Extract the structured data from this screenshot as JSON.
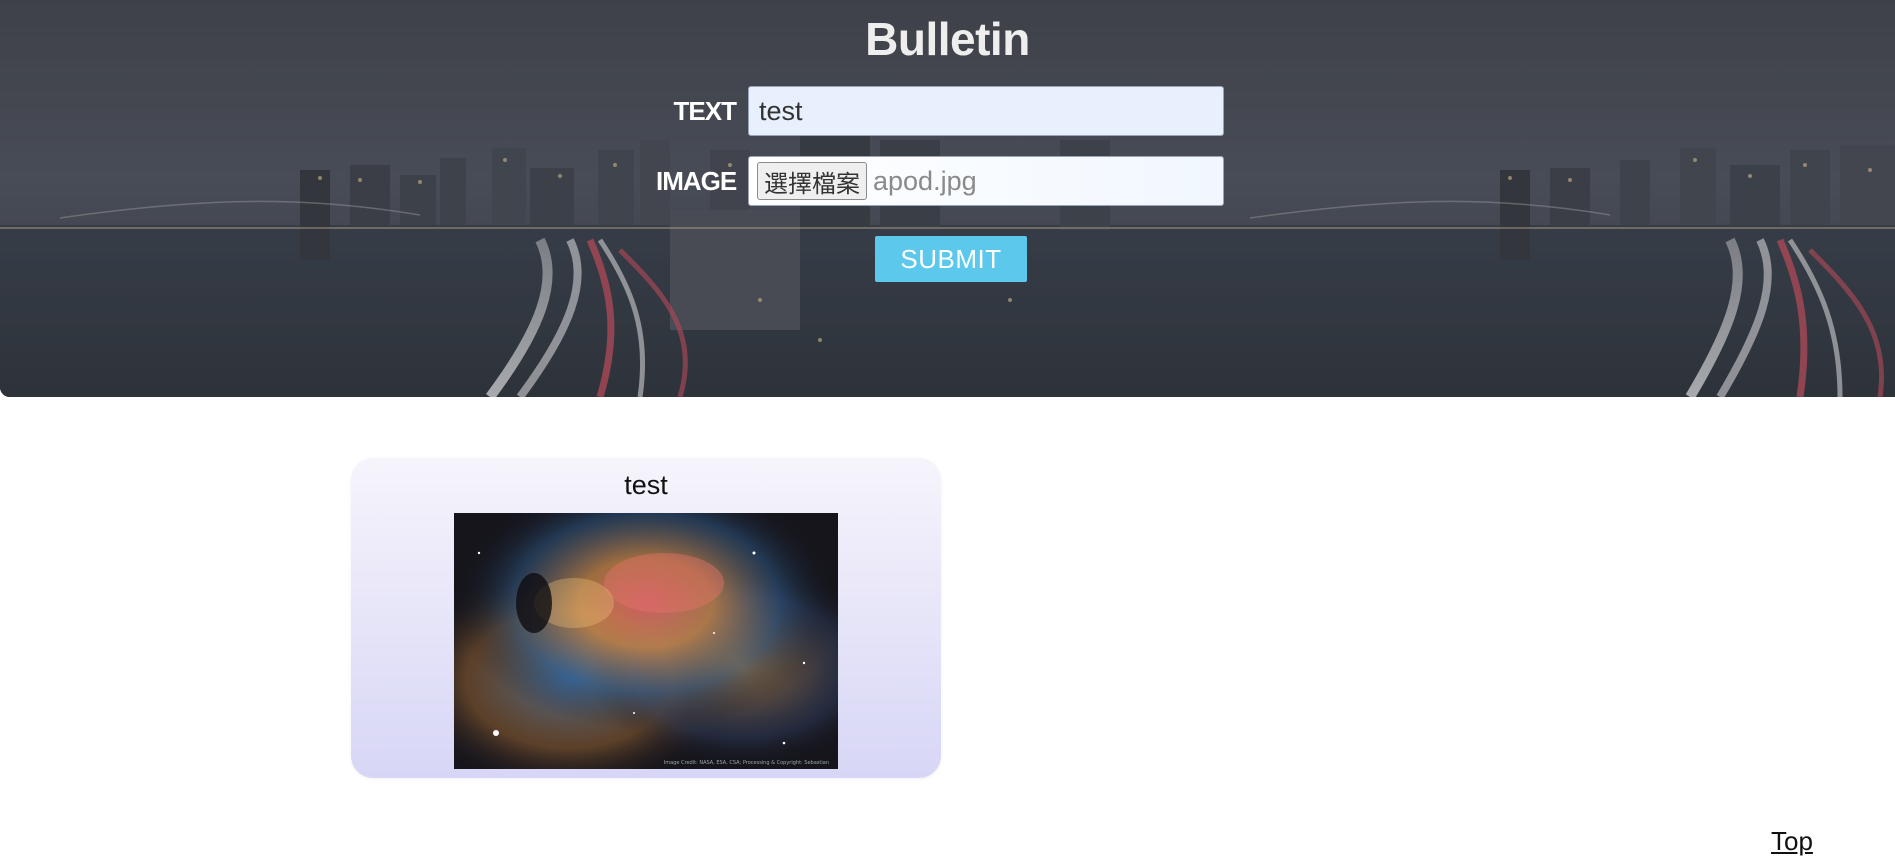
{
  "header": {
    "title": "Bulletin",
    "text_label": "TEXT",
    "text_value": "test",
    "image_label": "IMAGE",
    "file_button_label": "選擇檔案",
    "file_name": "apod.jpg",
    "submit_label": "SUBMIT"
  },
  "posts": [
    {
      "text": "test",
      "image_caption": "Image Credit: NASA, ESA, CSA; Processing & Copyright: Sebastian"
    }
  ],
  "footer": {
    "top_link": "Top"
  },
  "colors": {
    "submit": "#5bc8ec",
    "input_bg": "#e8f0fe",
    "card_top": "#f6f4fb",
    "card_bottom": "#d7d6f6"
  }
}
